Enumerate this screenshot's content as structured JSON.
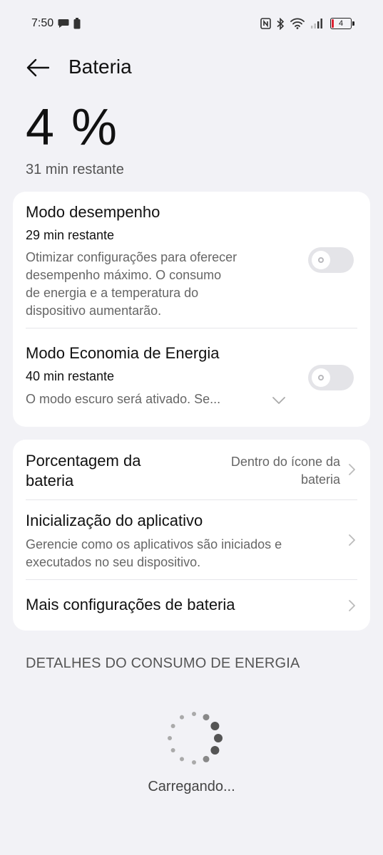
{
  "status_bar": {
    "time": "7:50",
    "battery_level": "4",
    "icons": [
      "message-icon",
      "battery-saver-icon",
      "nfc-icon",
      "bluetooth-icon",
      "wifi-icon",
      "signal-icon",
      "battery-icon"
    ]
  },
  "header": {
    "title": "Bateria"
  },
  "battery": {
    "percent": "4 %",
    "remaining": "31 min restante"
  },
  "performance_mode": {
    "title": "Modo desempenho",
    "remaining": "29 min restante",
    "description_lines": [
      "Otimizar configurações para oferecer",
      "desempenho máximo. O consumo",
      "de energia e a temperatura do",
      "dispositivo aumentarão."
    ],
    "enabled": false
  },
  "power_saving": {
    "title": "Modo Economia de Energia",
    "remaining": "40 min restante",
    "description": "O modo escuro será ativado. Se...",
    "enabled": false
  },
  "battery_percentage": {
    "title_lines": [
      "Porcentagem da",
      "bateria"
    ],
    "value_lines": [
      "Dentro do ícone da",
      "bateria"
    ]
  },
  "app_launch": {
    "title": "Inicialização do aplicativo",
    "description_lines": [
      "Gerencie como os aplicativos são iniciados e",
      "executados no seu dispositivo."
    ]
  },
  "more_settings": {
    "title": "Mais configurações de bateria"
  },
  "consumption": {
    "section_title": "DETALHES DO CONSUMO DE ENERGIA",
    "loading_text": "Carregando..."
  },
  "colors": {
    "background": "#f2f2f6",
    "card": "#ffffff",
    "toggle_off": "#e4e4e8",
    "battery_low": "#dd2233"
  }
}
